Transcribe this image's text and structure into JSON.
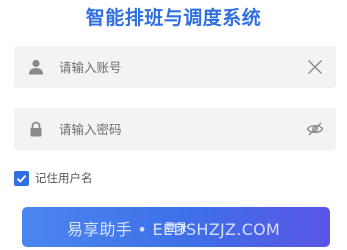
{
  "title": "智能排班与调度系统",
  "account": {
    "placeholder": "请输入账号",
    "value": "",
    "leading_icon": "user-icon",
    "trailing_icon": "clear-x-icon"
  },
  "password": {
    "placeholder": "请输入密码",
    "value": "",
    "leading_icon": "lock-icon",
    "trailing_icon": "eye-hidden-icon"
  },
  "remember": {
    "label": "记住用户名",
    "checked": true,
    "icon": "checkmark-icon"
  },
  "login_button": {
    "label": "登录"
  },
  "watermark": "易享助手 • EEDSHZJZ.COM",
  "colors": {
    "accent": "#2f6fe0",
    "field_bg": "#f2f3f5",
    "button_gradient_start": "#4b86f0",
    "button_gradient_end": "#5a55e6"
  }
}
